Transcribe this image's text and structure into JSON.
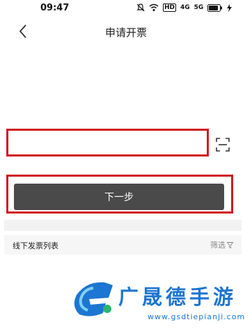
{
  "status_bar": {
    "time": "09:47",
    "icons": [
      "mute-icon",
      "wifi-icon",
      "hd-icon",
      "signal-4g-icon",
      "signal-5g-icon",
      "battery-icon",
      "charging-icon"
    ],
    "hd_label": "HD",
    "net1_label": "4G",
    "net2_label": "5G"
  },
  "header": {
    "title": "申请开票",
    "back_icon": "chevron-left-icon"
  },
  "form": {
    "input_value": "",
    "input_placeholder": "",
    "scan_icon": "scan-icon",
    "next_label": "下一步"
  },
  "offline_list": {
    "title": "线下发票列表",
    "filter_label": "筛选",
    "filter_icon": "filter-icon"
  },
  "watermark": {
    "name": "广晟德手游",
    "url": "www.gsdtiepianji.com"
  },
  "colors": {
    "highlight": "#d0191f",
    "button": "#4a4a4a",
    "watermark": "#1c76d2"
  }
}
